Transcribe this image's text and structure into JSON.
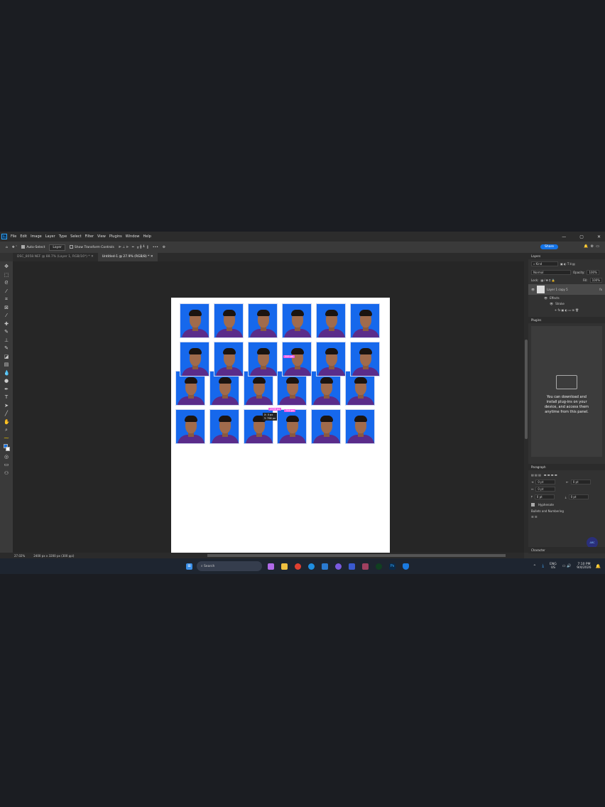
{
  "app": {
    "logo": "Ps",
    "menu": [
      "File",
      "Edit",
      "Image",
      "Layer",
      "Type",
      "Select",
      "Filter",
      "View",
      "Plugins",
      "Window",
      "Help"
    ]
  },
  "options": {
    "auto_select": "Auto-Select",
    "layer_select": "Layer",
    "show_transform": "Show Transform Controls",
    "more": "•••",
    "share": "Share"
  },
  "tabs": [
    {
      "label": "DSC_8058.NEF @ 88.7% (Layer 1, RGB/16*) *"
    },
    {
      "label": "Untitled-1 @ 27.9% (RGB/8) *"
    }
  ],
  "canvas": {
    "measure_1": "355 px",
    "measure_2": "2006 px",
    "measure_3": "755 px",
    "tip_x": "X: 0 px",
    "tip_y": "Y: 796 px"
  },
  "layers": {
    "title": "Layers",
    "filter": "Kind",
    "blend": "Normal",
    "opacity_label": "Opacity:",
    "opacity": "100%",
    "lock_label": "Lock:",
    "fill_label": "Fill:",
    "fill": "100%",
    "layer_name": "Layer 1 copy 5",
    "effects": "Effects",
    "stroke": "Stroke"
  },
  "plugins": {
    "title": "Plugins",
    "message": "You can download and install plug-ins on your device, and access them anytime from this panel."
  },
  "paragraph": {
    "title": "Paragraph",
    "indent_left": "0 pt",
    "indent_right": "0 pt",
    "indent_first": "0 pt",
    "space_before": "0 pt",
    "space_after": "0 pt",
    "hyphenate": "Hyphenate",
    "bullets": "Bullets and Numbering"
  },
  "character": {
    "title": "Character"
  },
  "status": {
    "zoom": "27.02%",
    "doc_size": "2400 px x 3200 px (300 ppi)"
  },
  "taskbar": {
    "search": "Search",
    "lang": "ENG",
    "region": "US",
    "time": "7:10 PM",
    "date": "9/4/2026"
  },
  "colors": {
    "accent": "#1473e6",
    "photo_bg": "#1668ec",
    "shirt": "#5a2c8a",
    "measure": "#f05ae6"
  }
}
